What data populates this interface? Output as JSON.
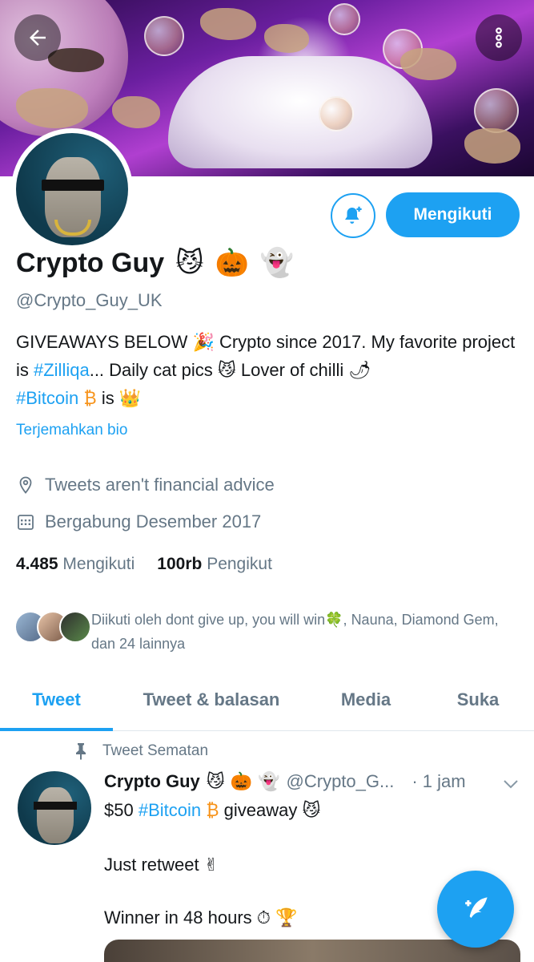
{
  "profile": {
    "name": "Crypto Guy",
    "name_emojis": [
      "😼",
      "🎃",
      "👻"
    ],
    "handle": "@Crypto_Guy_UK",
    "follow_button_label": "Mengikuti",
    "bio": {
      "part1": "GIVEAWAYS BELOW ",
      "emoji1": "🎉",
      "part2": " Crypto since 2017. My favorite project is ",
      "tag1": "#Zilliqa",
      "part3": "... Daily cat pics ",
      "emoji2": "😼",
      "part4": " Lover of chilli ",
      "emoji3": "🌶",
      "tag2": "#Bitcoin",
      "emoji4": "₿",
      "part5": " is ",
      "emoji5": "👑"
    },
    "translate_label": "Terjemahkan bio",
    "location": "Tweets aren't financial advice",
    "joined": "Bergabung Desember 2017",
    "following_count": "4.485",
    "following_label": "Mengikuti",
    "followers_count": "100rb",
    "followers_label": "Pengikut",
    "followed_by_text": "Diikuti oleh dont give up, you will win🍀, Nauna, Diamond Gem, dan 24 lainnya"
  },
  "tabs": [
    {
      "label": "Tweet",
      "active": true
    },
    {
      "label": "Tweet & balasan",
      "active": false
    },
    {
      "label": "Media",
      "active": false
    },
    {
      "label": "Suka",
      "active": false
    }
  ],
  "pinned_tweet": {
    "pinned_label": "Tweet Sematan",
    "author_name": "Crypto Guy",
    "author_emojis": "😼 🎃 👻",
    "author_handle": "@Crypto_G...",
    "time": "· 1 jam",
    "line1_prefix": "$50 ",
    "line1_tag": "#Bitcoin",
    "line1_emoji": "₿",
    "line1_suffix": "  giveaway 😼",
    "line2": "Just retweet ✌",
    "line3": "Winner in 48 hours ⏱ 🏆"
  },
  "colors": {
    "accent": "#1da1f2",
    "secondary_text": "#657786",
    "primary_text": "#14171a"
  },
  "icons": [
    "back-arrow-icon",
    "more-vertical-icon",
    "bell-plus-icon",
    "location-pin-icon",
    "calendar-icon",
    "pin-icon",
    "chevron-down-icon",
    "compose-tweet-icon"
  ]
}
